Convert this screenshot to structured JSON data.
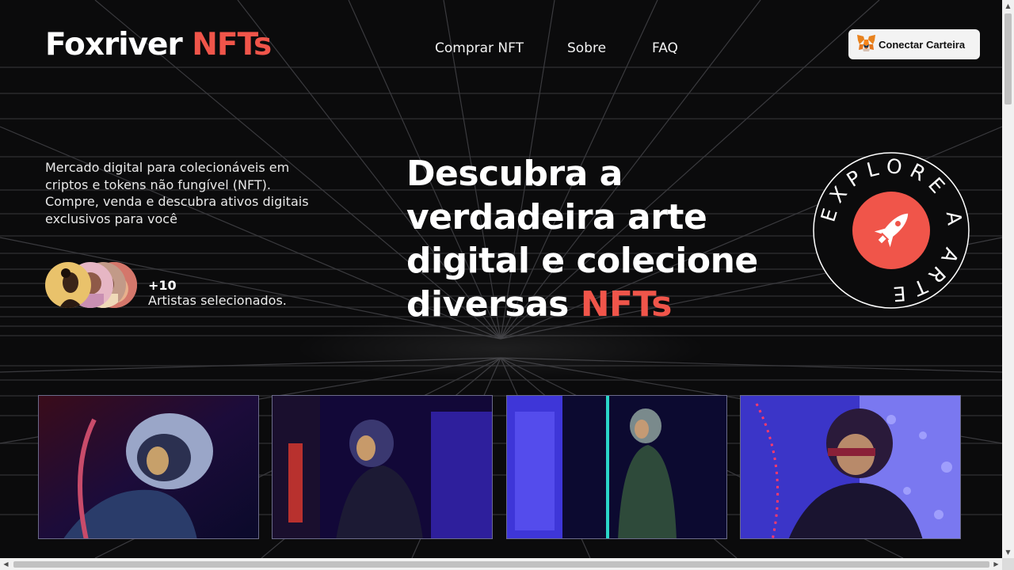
{
  "header": {
    "logo_main": "Foxriver",
    "logo_accent": "NFTs",
    "nav": [
      "Comprar NFT",
      "Sobre",
      "FAQ"
    ],
    "wallet_button": "Conectar Carteira"
  },
  "hero": {
    "description": "Mercado digital para colecionáveis em criptos e tokens não fungível (NFT). Compre, venda e descubra ativos digitais exclusivos para você",
    "artists_count": "+10",
    "artists_label": "Artistas selecionados.",
    "headline_lines": [
      "Descubra a",
      "verdadeira arte",
      "digital e colecione",
      "diversas "
    ],
    "headline_accent": "NFTs",
    "badge_text": "EXPLORE A ARTE"
  },
  "gallery": [
    {
      "name": "astronaut-red-helmet"
    },
    {
      "name": "astronaut-purple-corridor"
    },
    {
      "name": "astronaut-green-suit"
    },
    {
      "name": "astronaut-blue-mask"
    }
  ],
  "colors": {
    "accent": "#f0554a",
    "background": "#0b0b0c",
    "button_bg": "#f3f3f3"
  },
  "icons": [
    "metamask-fox-icon",
    "rocket-icon"
  ]
}
